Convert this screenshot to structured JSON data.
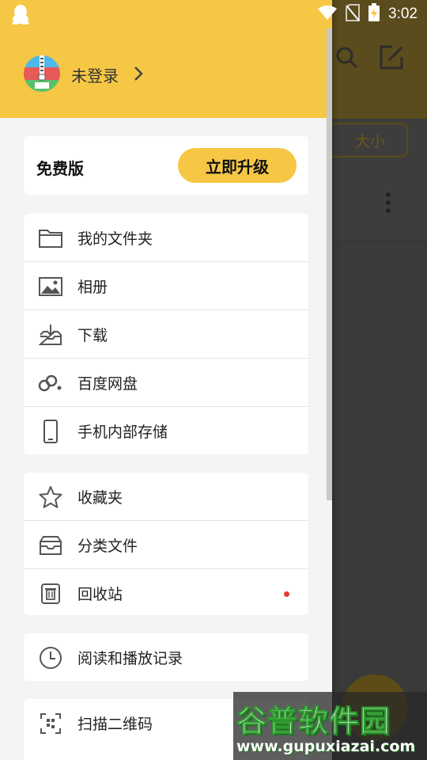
{
  "status_bar": {
    "time": "3:02"
  },
  "background": {
    "size_button": "大小"
  },
  "drawer": {
    "login_text": "未登录",
    "plan_label": "免费版",
    "upgrade_button": "立即升级",
    "group1": [
      {
        "icon": "folder-icon",
        "label": "我的文件夹"
      },
      {
        "icon": "image-icon",
        "label": "相册"
      },
      {
        "icon": "download-icon",
        "label": "下载"
      },
      {
        "icon": "baidu-netdisk-icon",
        "label": "百度网盘"
      },
      {
        "icon": "phone-icon",
        "label": "手机内部存储"
      }
    ],
    "group2": [
      {
        "icon": "star-icon",
        "label": "收藏夹"
      },
      {
        "icon": "category-box-icon",
        "label": "分类文件"
      },
      {
        "icon": "trash-icon",
        "label": "回收站"
      }
    ],
    "group3": [
      {
        "icon": "clock-icon",
        "label": "阅读和播放记录"
      }
    ],
    "group4": [
      {
        "icon": "qr-scan-icon",
        "label": "扫描二维码"
      }
    ]
  },
  "watermark": {
    "title": "谷普软件园",
    "url": "www.gupuxiazai.com"
  },
  "colors": {
    "accent": "#f5c745",
    "badge_dot": "#e83a2f",
    "drawer_bg": "#f4f4f4"
  }
}
